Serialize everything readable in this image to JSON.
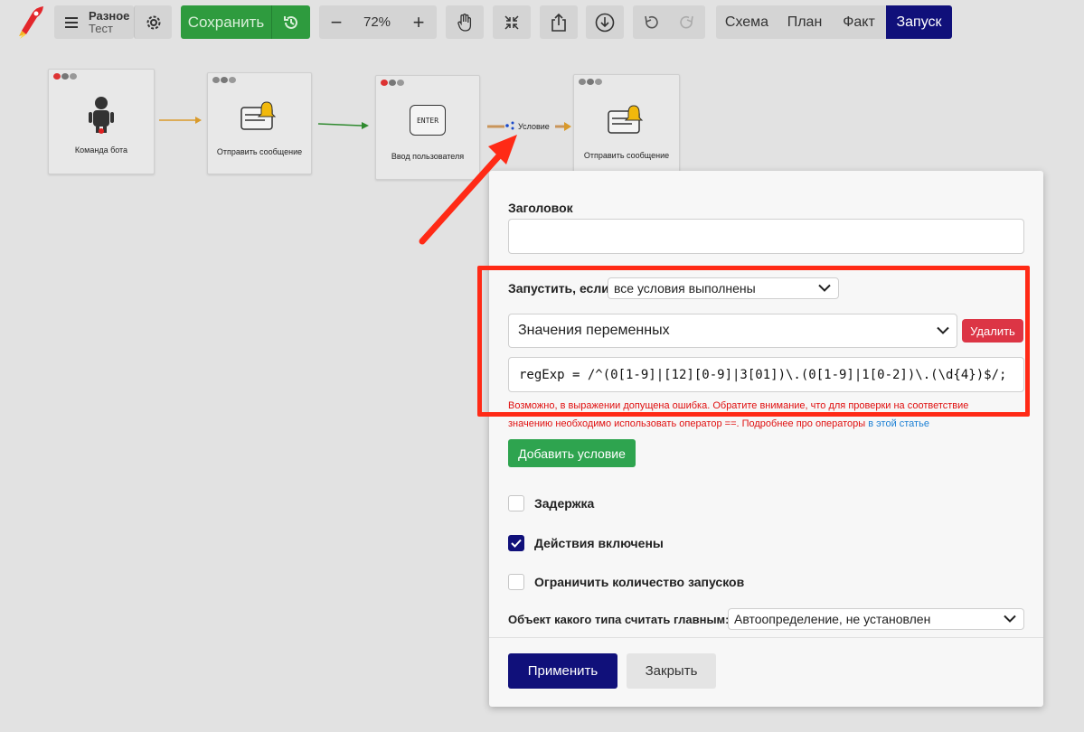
{
  "toolbar": {
    "project_name": "Разное",
    "project_sub": "Тест",
    "save_label": "Сохранить",
    "zoom_value": "72%",
    "zoom_out": "−",
    "zoom_in": "+",
    "modes": [
      "Схема",
      "План",
      "Факт",
      "Запуск"
    ],
    "active_mode": "Запуск"
  },
  "canvas": {
    "nodes": [
      {
        "caption": "Команда бота",
        "icon": "robot-icon"
      },
      {
        "caption": "Отправить сообщение",
        "icon": "message-bell-icon"
      },
      {
        "caption": "Ввод пользователя",
        "icon": "enter-key-icon",
        "key_label": "ENTER"
      },
      {
        "caption": "Отправить сообщение",
        "icon": "message-bell-icon"
      }
    ],
    "condition_label": "Условие"
  },
  "modal": {
    "title_label": "Заголовок",
    "title_value": "",
    "run_if_label": "Запустить, если",
    "run_if_value": "все условия выполнены",
    "condition_type": "Значения переменных",
    "delete_label": "Удалить",
    "expression": "regExp = /^(0[1-9]|[12][0-9]|3[01])\\.(0[1-9]|1[0-2])\\.(\\d{4})$/;",
    "warning_line1": "Возможно, в выражении допущена ошибка. Обратите внимание, что для проверки на соответствие",
    "warning_line2": "значению необходимо использовать оператор ==. Подробнее про операторы ",
    "warning_link": "в этой статье",
    "add_condition_label": "Добавить условие",
    "checkboxes": [
      {
        "label": "Задержка",
        "checked": false
      },
      {
        "label": "Действия включены",
        "checked": true
      },
      {
        "label": "Ограничить количество запусков",
        "checked": false
      }
    ],
    "main_object_label": "Объект какого типа считать главным:",
    "main_object_value": "Автоопределение, не установлен",
    "apply_label": "Применить",
    "close_label": "Закрыть"
  },
  "colors": {
    "accent": "#10107a",
    "save_green": "#2e9b3e",
    "danger": "#dc3545",
    "annotation": "#ff2a16"
  }
}
